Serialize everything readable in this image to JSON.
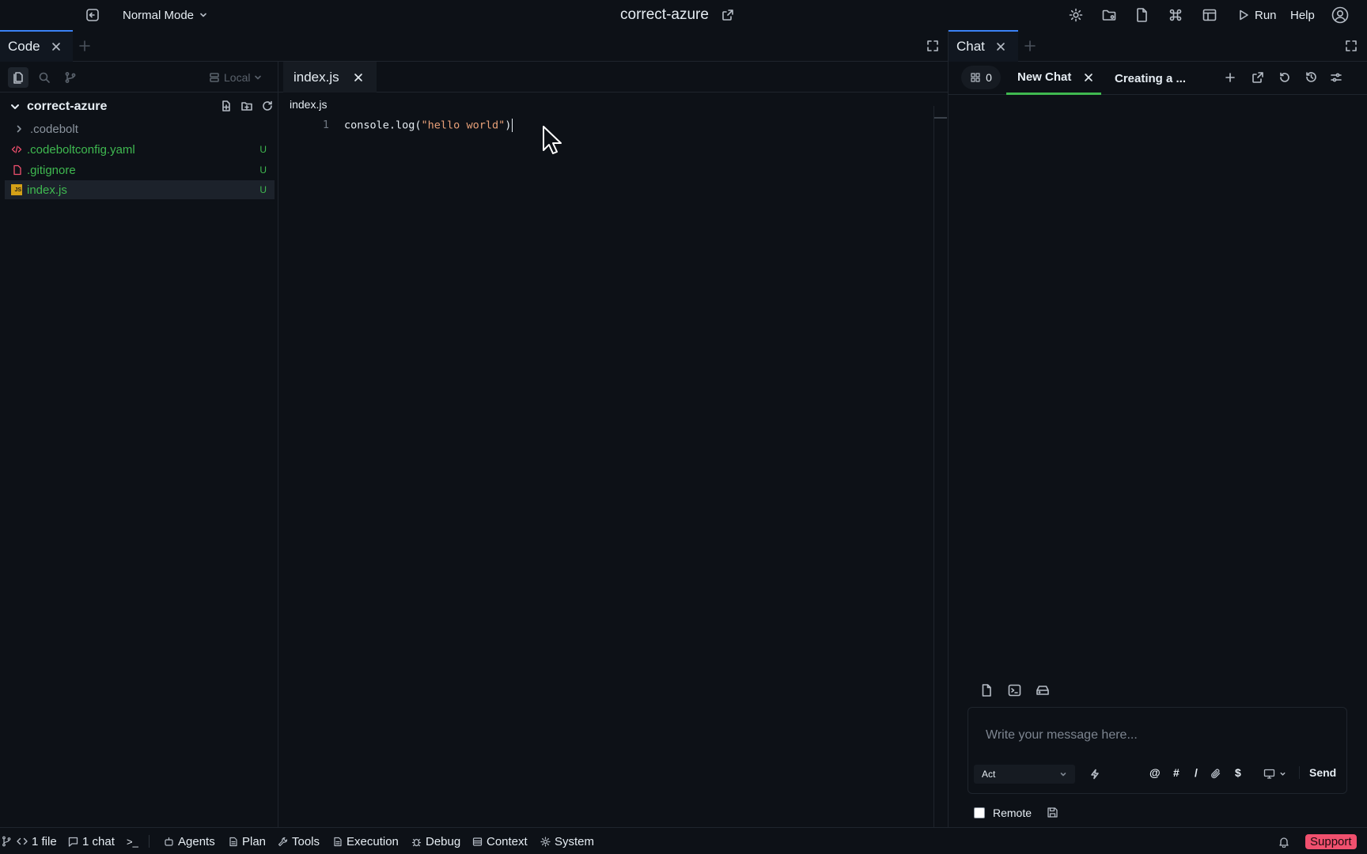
{
  "topbar": {
    "mode_label": "Normal Mode",
    "project_title": "correct-azure",
    "run_label": "Run",
    "help_label": "Help"
  },
  "code_panel": {
    "tab_label": "Code"
  },
  "explorer": {
    "location": "Local",
    "root_folder": "correct-azure",
    "items": [
      {
        "name": ".codebolt",
        "status": ""
      },
      {
        "name": ".codeboltconfig.yaml",
        "status": "U"
      },
      {
        "name": ".gitignore",
        "status": "U"
      },
      {
        "name": "index.js",
        "status": "U"
      }
    ]
  },
  "editor": {
    "tab_label": "index.js",
    "breadcrumb": "index.js",
    "line_number": "1",
    "code": {
      "prefix": "console.log(",
      "string": "\"hello world\"",
      "suffix": ")"
    }
  },
  "chat_panel": {
    "tab_label": "Chat",
    "count": "0",
    "tabs": [
      "New Chat",
      "Creating a ..."
    ],
    "input_placeholder": "Write your message here...",
    "mode_select": "Act",
    "shortcut_at": "@",
    "shortcut_hash": "#",
    "shortcut_slash": "/",
    "shortcut_dollar": "$",
    "send_label": "Send",
    "remote_label": "Remote"
  },
  "statusbar": {
    "files": "1 file",
    "chats": "1 chat",
    "terminal": ">_",
    "items": [
      "Agents",
      "Plan",
      "Tools",
      "Execution",
      "Debug",
      "Context",
      "System"
    ],
    "support_label": "Support"
  },
  "colors": {
    "background": "#0d1117",
    "accent": "#3b82f6",
    "git_untracked": "#3fb950",
    "active_chat_tab": "#3fb950",
    "support_badge": "#f0506e",
    "code_string": "#e9a179"
  }
}
